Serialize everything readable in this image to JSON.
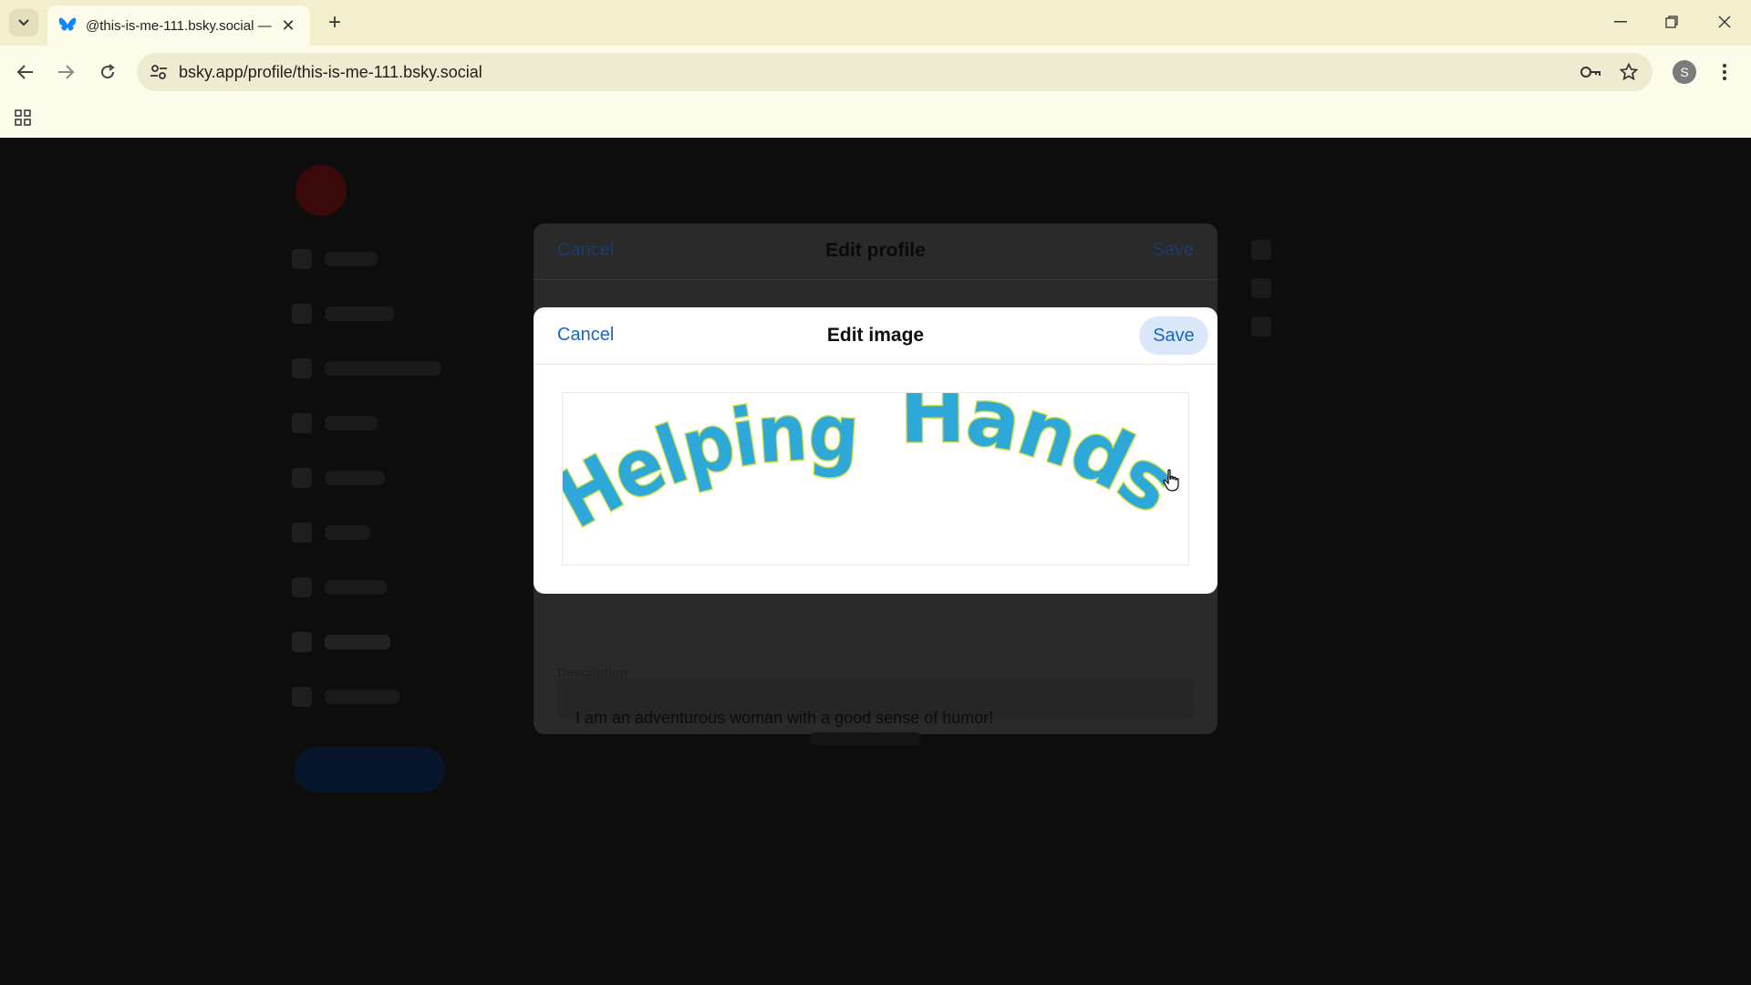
{
  "browser": {
    "tab_title": "@this-is-me-111.bsky.social —",
    "url": "bsky.app/profile/this-is-me-111.bsky.social",
    "profile_initial": "S"
  },
  "edit_profile": {
    "cancel_label": "Cancel",
    "title": "Edit profile",
    "save_label": "Save",
    "description_label": "Description",
    "description_value": "I am an adventurous woman with a good sense of humor!"
  },
  "edit_image": {
    "cancel_label": "Cancel",
    "title": "Edit image",
    "save_label": "Save",
    "banner_text": "Helping Hands"
  },
  "colors": {
    "brand_blue": "#1a64c8",
    "banner_fill": "#2ea8d8",
    "banner_outline": "#cde04a"
  }
}
